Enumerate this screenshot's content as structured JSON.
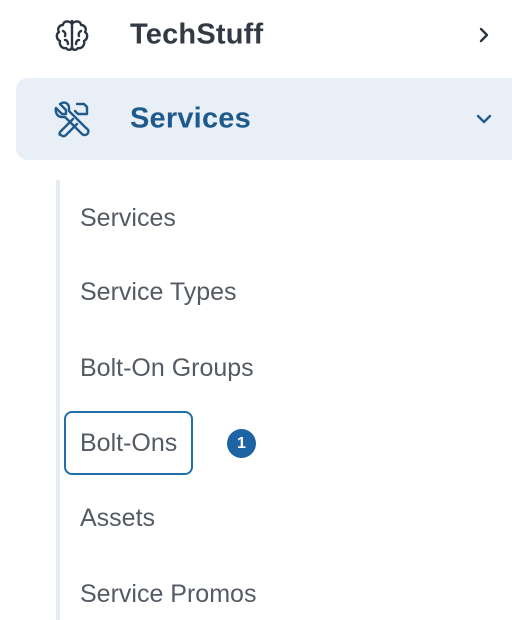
{
  "nav": {
    "techstuff": {
      "label": "TechStuff",
      "icon": "brain-icon",
      "expanded": false
    },
    "services": {
      "label": "Services",
      "icon": "tools-icon",
      "expanded": true
    },
    "submenu": [
      {
        "label": "Services"
      },
      {
        "label": "Service Types"
      },
      {
        "label": "Bolt-On Groups"
      },
      {
        "label": "Bolt-Ons",
        "selected": true,
        "badge": "1"
      },
      {
        "label": "Assets"
      },
      {
        "label": "Service Promos"
      }
    ]
  },
  "colors": {
    "active_bg": "#e9eff7",
    "active_text": "#1e5a8c",
    "badge": "#1e63a3",
    "focus_border": "#1f6fa8"
  }
}
